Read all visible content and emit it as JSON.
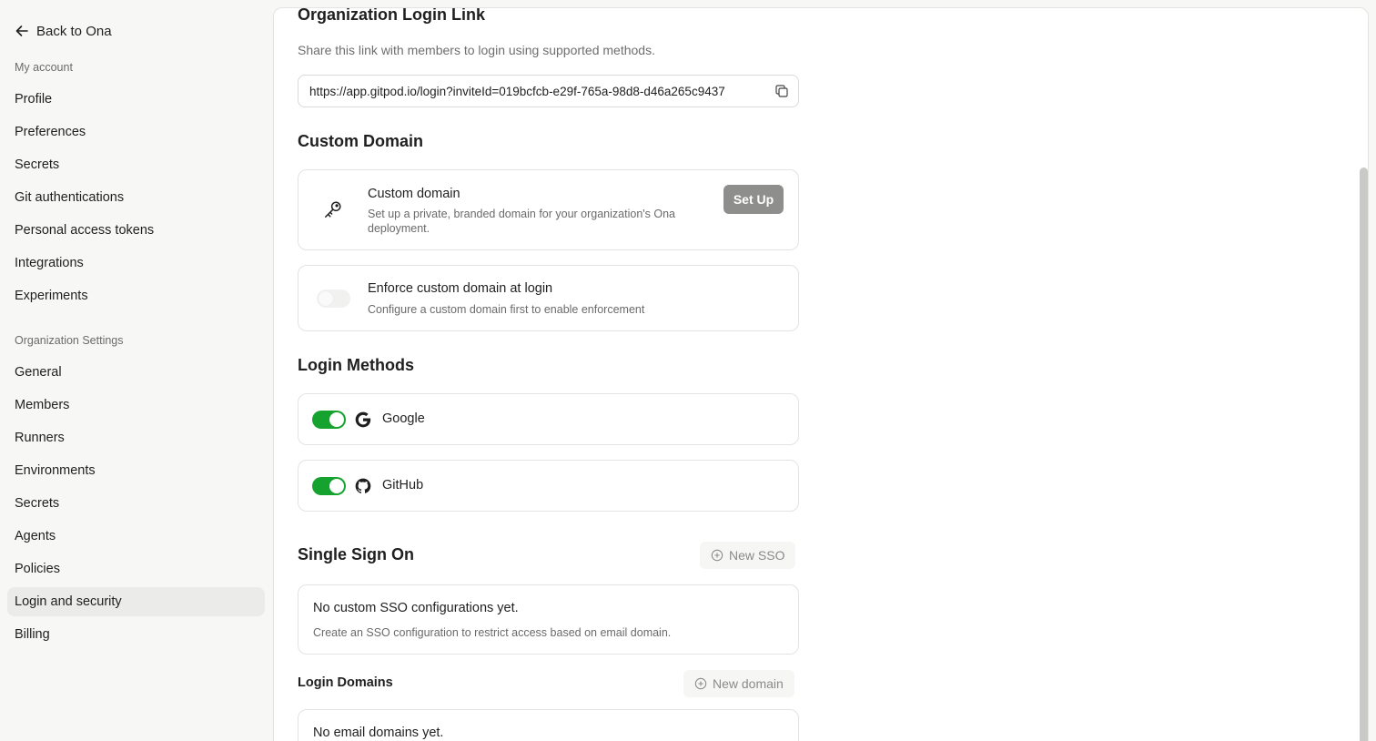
{
  "sidebar": {
    "back_label": "Back to Ona",
    "my_account_label": "My account",
    "account_items": [
      "Profile",
      "Preferences",
      "Secrets",
      "Git authentications",
      "Personal access tokens",
      "Integrations",
      "Experiments"
    ],
    "org_label": "Organization Settings",
    "org_items": [
      "General",
      "Members",
      "Runners",
      "Environments",
      "Secrets",
      "Agents",
      "Policies",
      "Login and security",
      "Billing"
    ],
    "active_item": "Login and security"
  },
  "org_login_link": {
    "title": "Organization Login Link",
    "description": "Share this link with members to login using supported methods.",
    "url": "https://app.gitpod.io/login?inviteId=019bcfcb-e29f-765a-98d8-d46a265c9437"
  },
  "custom_domain": {
    "heading": "Custom Domain",
    "card_title": "Custom domain",
    "card_desc": "Set up a private, branded domain for your organization's Ona deployment.",
    "setup_label": "Set Up",
    "enforce_title": "Enforce custom domain at login",
    "enforce_desc": "Configure a custom domain first to enable enforcement",
    "enforce_enabled": false
  },
  "login_methods": {
    "heading": "Login Methods",
    "items": [
      {
        "name": "Google",
        "enabled": true,
        "icon": "google-icon"
      },
      {
        "name": "GitHub",
        "enabled": true,
        "icon": "github-icon"
      }
    ]
  },
  "sso": {
    "heading": "Single Sign On",
    "new_label": "New SSO",
    "empty_title": "No custom SSO configurations yet.",
    "empty_desc": "Create an SSO configuration to restrict access based on email domain."
  },
  "login_domains": {
    "heading": "Login Domains",
    "new_label": "New domain",
    "empty_title": "No email domains yet."
  },
  "colors": {
    "toggle_on": "#16a22e",
    "active_nav_bg": "#ebebea",
    "setup_button": "#8e8e8c"
  }
}
